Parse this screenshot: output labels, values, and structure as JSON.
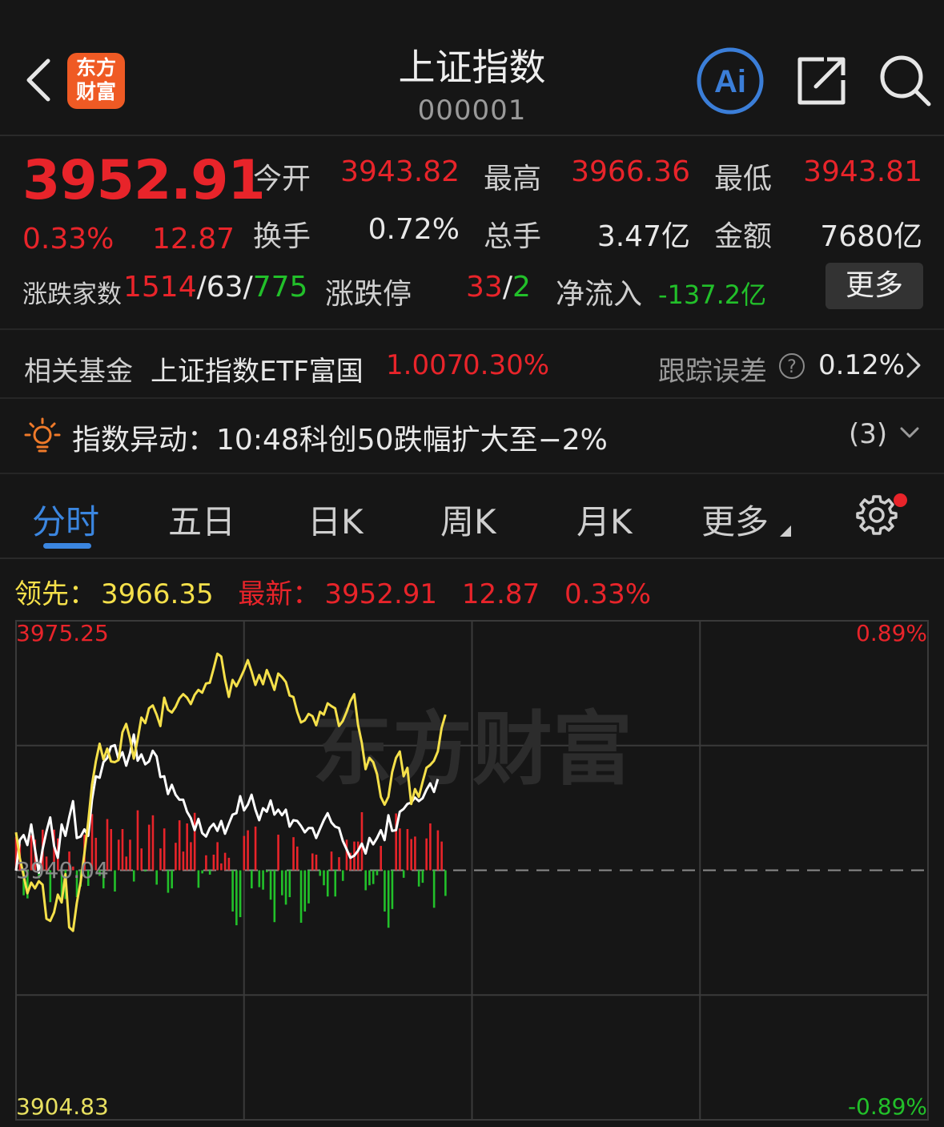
{
  "header": {
    "title": "上证指数",
    "code": "000001",
    "logo_line1": "东方",
    "logo_line2": "财富",
    "ai_label": "Ai"
  },
  "quote": {
    "price": "3952.91",
    "change_pct": "0.33%",
    "change": "12.87",
    "open_label": "今开",
    "open": "3943.82",
    "high_label": "最高",
    "high": "3966.36",
    "low_label": "最低",
    "low": "3943.81",
    "turnover_label": "换手",
    "turnover": "0.72%",
    "volume_label": "总手",
    "volume": "3.47亿",
    "amount_label": "金额",
    "amount": "7680亿",
    "advdec_label": "涨跌家数",
    "adv": "1514",
    "sep1": "/",
    "flat": "63",
    "sep2": "/",
    "dec": "775",
    "limit_label": "涨跌停",
    "limit_up": "33",
    "limit_sep": "/",
    "limit_down": "2",
    "netflow_label": "净流入",
    "netflow": "-137.2亿",
    "more_button": "更多"
  },
  "fund": {
    "label": "相关基金",
    "name": "上证指数ETF富国",
    "price": "1.007",
    "pct": "0.30%",
    "tracking_label": "跟踪误差",
    "tracking_value": "0.12%"
  },
  "alert": {
    "label": "指数异动：",
    "text": "10:48科创50跌幅扩大至−2%",
    "count": "(3)"
  },
  "tabs": [
    "分时",
    "五日",
    "日K",
    "周K",
    "月K",
    "更多"
  ],
  "active_tab": 0,
  "readout": {
    "lead_label": "领先：",
    "lead_value": "3966.35",
    "latest_label": "最新：",
    "latest_value": "3952.91",
    "latest_change": "12.87",
    "latest_pct": "0.33%"
  },
  "chart_data": {
    "type": "line",
    "y_top_label": "3975.25",
    "y_mid_label": "3940.04",
    "y_bottom_label": "3904.83",
    "pct_top_label": "0.89%",
    "pct_bottom_label": "-0.89%",
    "watermark": "东方财富",
    "ylim": [
      3904.83,
      3975.25
    ],
    "baseline": 3940.04,
    "total_minutes": 241,
    "colors": {
      "price": "#ffffff",
      "lead": "#f5e04a",
      "up": "#e8242a",
      "down": "#22c02a",
      "grid": "#3a3a3a"
    },
    "series": [
      {
        "name": "",
        "color": "#ffffff",
        "values": [
          3940.0,
          3944.3,
          3945.0,
          3943.6,
          3946.5,
          3943.0,
          3939.7,
          3943.0,
          3945.5,
          3947.5,
          3943.5,
          3941.8,
          3946.5,
          3944.9,
          3947.5,
          3949.8,
          3944.6,
          3944.8,
          3945.8,
          3944.9,
          3950.0,
          3953.3,
          3953.1,
          3955.3,
          3955.9,
          3957.5,
          3957.7,
          3955.7,
          3956.7,
          3954.8,
          3956.6,
          3959.2,
          3955.5,
          3956.4,
          3955.0,
          3955.4,
          3956.9,
          3956.1,
          3953.2,
          3953.3,
          3950.8,
          3952.1,
          3950.7,
          3950.0,
          3950.0,
          3948.3,
          3947.4,
          3945.7,
          3947.3,
          3945.3,
          3944.8,
          3946.0,
          3946.6,
          3945.6,
          3947.0,
          3945.2,
          3946.6,
          3947.9,
          3948.1,
          3950.5,
          3948.5,
          3949.3,
          3950.7,
          3948.6,
          3947.1,
          3948.8,
          3948.3,
          3949.9,
          3947.9,
          3948.6,
          3947.8,
          3948.6,
          3946.2,
          3947.1,
          3947.0,
          3946.3,
          3945.4,
          3946.0,
          3946.0,
          3944.6,
          3945.9,
          3947.1,
          3948.1,
          3946.8,
          3946.2,
          3946.0,
          3944.2,
          3943.0,
          3941.8,
          3942.1,
          3942.8,
          3943.8,
          3942.4,
          3944.6,
          3943.7,
          3944.6,
          3945.7,
          3944.3,
          3947.8,
          3945.6,
          3945.7,
          3948.3,
          3948.7,
          3949.4,
          3949.6,
          3950.3,
          3949.8,
          3950.2,
          3951.4,
          3952.3,
          3951.1,
          3952.9
        ]
      },
      {
        "name": "",
        "color": "#f5e04a",
        "values": [
          3945.4,
          3941.8,
          3939.3,
          3936.8,
          3938.3,
          3937.5,
          3938.5,
          3938.0,
          3933.2,
          3932.9,
          3934.1,
          3936.6,
          3935.5,
          3939.5,
          3932.0,
          3931.5,
          3935.4,
          3938.4,
          3942.4,
          3946.9,
          3952.1,
          3955.4,
          3957.9,
          3955.7,
          3957.2,
          3955.4,
          3955.3,
          3955.6,
          3959.5,
          3960.7,
          3958.6,
          3955.8,
          3958.5,
          3961.6,
          3960.8,
          3962.9,
          3963.3,
          3962.0,
          3960.4,
          3964.4,
          3962.7,
          3962.3,
          3963.1,
          3964.3,
          3964.9,
          3964.4,
          3963.5,
          3964.8,
          3965.5,
          3965.1,
          3966.4,
          3966.5,
          3968.5,
          3970.6,
          3970.2,
          3967.0,
          3964.5,
          3966.9,
          3966.0,
          3967.1,
          3968.3,
          3969.7,
          3968.1,
          3966.2,
          3967.6,
          3966.3,
          3968.3,
          3967.0,
          3965.5,
          3967.8,
          3967.3,
          3966.6,
          3964.7,
          3964.5,
          3962.4,
          3960.9,
          3961.2,
          3962.1,
          3961.8,
          3960.5,
          3962.4,
          3962.0,
          3963.6,
          3963.2,
          3962.9,
          3960.4,
          3961.1,
          3962.4,
          3963.9,
          3964.9,
          3960.6,
          3958.0,
          3954.3,
          3955.9,
          3955.3,
          3953.6,
          3950.4,
          3949.3,
          3950.4,
          3953.9,
          3955.9,
          3956.8,
          3953.3,
          3954.5,
          3949.4,
          3951.5,
          3950.4,
          3952.5,
          3954.5,
          3954.9,
          3955.5,
          3956.8,
          3960.1,
          3962.0
        ]
      }
    ],
    "volume": [
      0.53,
      0.42,
      -0.4,
      -0.45,
      0.56,
      0.49,
      -0.13,
      0.65,
      0.22,
      -0.51,
      0.65,
      0.51,
      -0.53,
      -0.46,
      0.3,
      0.06,
      -0.43,
      -0.26,
      0.57,
      -0.25,
      0.9,
      0.52,
      -0.09,
      -0.29,
      0.82,
      0.66,
      -0.34,
      0.49,
      0.66,
      0.22,
      0.49,
      -0.18,
      0.96,
      0.35,
      -0.02,
      0.73,
      0.88,
      -0.23,
      0.35,
      0.67,
      -0.36,
      -0.29,
      0.44,
      0.8,
      0.3,
      0.75,
      0.45,
      0.92,
      -0.28,
      -0.05,
      0.24,
      -0.07,
      0.25,
      0.45,
      0.11,
      0.28,
      0.2,
      -0.66,
      -0.88,
      -0.75,
      0.55,
      0.64,
      -0.29,
      0.7,
      -0.27,
      -0.31,
      -0.03,
      -0.47,
      -0.83,
      0.57,
      -0.4,
      -0.55,
      -0.43,
      0.53,
      0.38,
      -0.84,
      -0.66,
      -0.53,
      0.27,
      0.25,
      -0.09,
      -0.24,
      -0.42,
      0.3,
      -0.42,
      0.21,
      -0.17,
      0.49,
      0.28,
      0.46,
      0.46,
      0.93,
      -0.32,
      -0.24,
      -0.22,
      -0.08,
      0.39,
      -0.66,
      -0.92,
      -0.62,
      0.91,
      0.67,
      -0.12,
      0.66,
      0.5,
      0.54,
      -0.26,
      -0.2,
      0.51,
      0.75,
      -0.6,
      0.64,
      0.46,
      -0.41
    ]
  }
}
